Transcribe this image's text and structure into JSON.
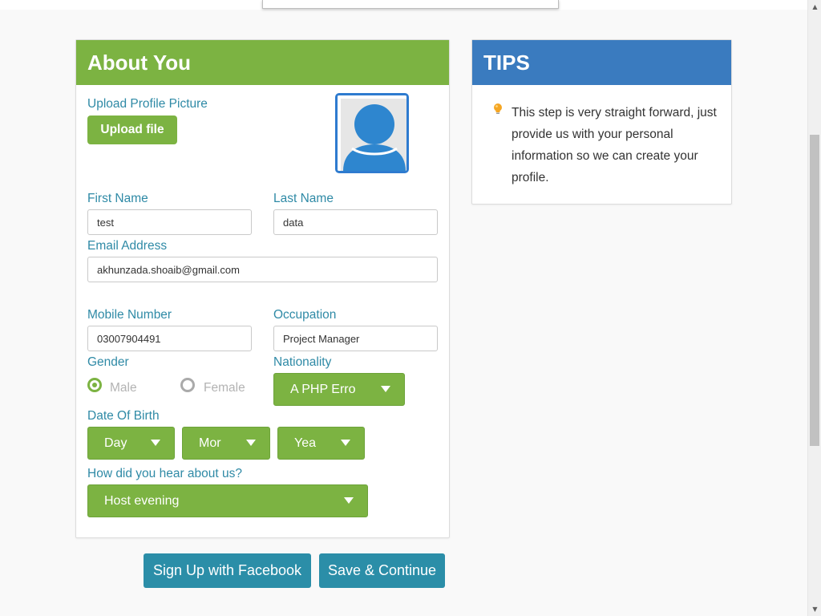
{
  "about": {
    "title": "About You",
    "upload_label": "Upload Profile Picture",
    "upload_button": "Upload file",
    "first_name_label": "First Name",
    "first_name_value": "test",
    "last_name_label": "Last Name",
    "last_name_value": "data",
    "email_label": "Email Address",
    "email_value": "akhunzada.shoaib@gmail.com",
    "mobile_label": "Mobile Number",
    "mobile_value": "03007904491",
    "occupation_label": "Occupation",
    "occupation_value": "Project Manager",
    "gender_label": "Gender",
    "gender_male": "Male",
    "gender_female": "Female",
    "gender_selected": "Male",
    "nationality_label": "Nationality",
    "nationality_value": "A PHP Erro",
    "dob_label": "Date Of Birth",
    "dob_day": "Day",
    "dob_month": "Mor",
    "dob_year": "Yea",
    "hear_label": "How did you hear about us?",
    "hear_value": "Host evening"
  },
  "tips": {
    "title": "TIPS",
    "text": "This step is very straight forward, just provide us with your personal information so we can create your profile."
  },
  "actions": {
    "facebook": "Sign Up with Facebook",
    "save": "Save & Continue"
  },
  "colors": {
    "green": "#7cb342",
    "blue_header": "#3a7bbf",
    "teal_button": "#2b8ea8",
    "label_text": "#2f8aa6"
  },
  "icons": {
    "avatar": "user-avatar-icon",
    "tip": "lightbulb-icon",
    "dropdown": "chevron-down-icon"
  }
}
